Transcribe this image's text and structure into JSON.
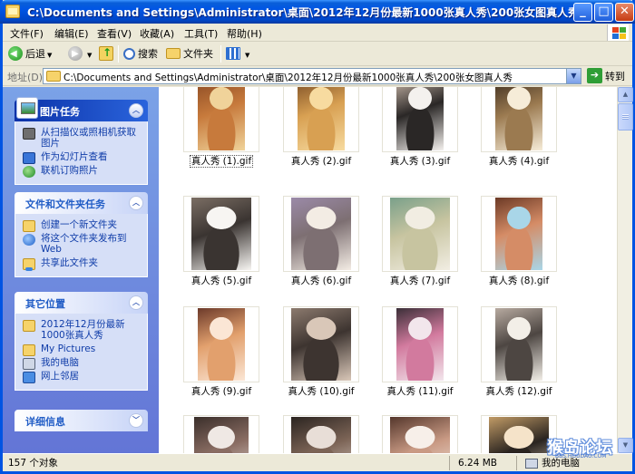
{
  "window": {
    "title": "C:\\Documents and Settings\\Administrator\\桌面\\2012年12月份最新1000张真人秀\\200张女图真人秀"
  },
  "menu": {
    "items": [
      "文件(F)",
      "编辑(E)",
      "查看(V)",
      "收藏(A)",
      "工具(T)",
      "帮助(H)"
    ]
  },
  "toolbar": {
    "back_label": "后退",
    "search_label": "搜索",
    "folders_label": "文件夹"
  },
  "address": {
    "label": "地址(D)",
    "path": "C:\\Documents and Settings\\Administrator\\桌面\\2012年12月份最新1000张真人秀\\200张女图真人秀",
    "go_label": "转到"
  },
  "tasks": {
    "picture_tasks": {
      "title": "图片任务",
      "items": [
        "从扫描仪或照相机获取图片",
        "作为幻灯片查看",
        "联机订购照片"
      ]
    },
    "file_folder_tasks": {
      "title": "文件和文件夹任务",
      "items": [
        "创建一个新文件夹",
        "将这个文件夹发布到 Web",
        "共享此文件夹"
      ]
    },
    "other_places": {
      "title": "其它位置",
      "items": [
        "2012年12月份最新1000张真人秀",
        "My Pictures",
        "我的电脑",
        "网上邻居"
      ]
    },
    "details": {
      "title": "详细信息"
    }
  },
  "files": [
    {
      "name": "真人秀 (1).gif",
      "colors": [
        "#f0d39a",
        "#c77a3c",
        "#8a4a24"
      ]
    },
    {
      "name": "真人秀 (2).gif",
      "colors": [
        "#f7dba0",
        "#d8a052",
        "#7a4d25"
      ]
    },
    {
      "name": "真人秀 (3).gif",
      "colors": [
        "#f4f1ee",
        "#2a2726",
        "#c8b6a8"
      ]
    },
    {
      "name": "真人秀 (4).gif",
      "colors": [
        "#f6ecd8",
        "#9b7a50",
        "#3c2d1f"
      ]
    },
    {
      "name": "真人秀 (5).gif",
      "colors": [
        "#f7f5f2",
        "#3a3431",
        "#7b6e64"
      ]
    },
    {
      "name": "真人秀 (6).gif",
      "colors": [
        "#f3ece4",
        "#7d6f72",
        "#9b8aa8"
      ]
    },
    {
      "name": "真人秀 (7).gif",
      "colors": [
        "#f1ede2",
        "#c7c4a0",
        "#7aa08a"
      ]
    },
    {
      "name": "真人秀 (8).gif",
      "colors": [
        "#a9d6e8",
        "#d58c66",
        "#6c3a26"
      ]
    },
    {
      "name": "真人秀 (9).gif",
      "colors": [
        "#fbe6d5",
        "#e2a06d",
        "#6c3a2a"
      ]
    },
    {
      "name": "真人秀 (10).gif",
      "colors": [
        "#d9c7b8",
        "#3d3430",
        "#8c7a6e"
      ]
    },
    {
      "name": "真人秀 (11).gif",
      "colors": [
        "#f2e6ec",
        "#d27a9e",
        "#3b2f38"
      ]
    },
    {
      "name": "真人秀 (12).gif",
      "colors": [
        "#f3efe8",
        "#4d4642",
        "#b7aaa0"
      ]
    },
    {
      "name": "",
      "colors": [
        "#efe8e4",
        "#8a6d63",
        "#3a2e2a"
      ]
    },
    {
      "name": "",
      "colors": [
        "#e8ded7",
        "#7c6456",
        "#2b2420"
      ]
    },
    {
      "name": "",
      "colors": [
        "#f7efe9",
        "#c99a84",
        "#55372c"
      ]
    },
    {
      "name": "",
      "colors": [
        "#f5e3c9",
        "#2a2420",
        "#c19b66"
      ]
    }
  ],
  "status": {
    "object_count": "157 个对象",
    "size": "6.24 MB",
    "location": "我的电脑"
  },
  "watermark": {
    "text": "猴岛论坛",
    "url": "BBS.HOUDAO.COM"
  },
  "icons": {
    "back": "back-arrow-icon",
    "forward": "forward-arrow-icon",
    "up": "up-folder-icon",
    "search": "search-icon",
    "folders": "folder-icon",
    "views": "views-icon",
    "go": "go-arrow-icon"
  }
}
